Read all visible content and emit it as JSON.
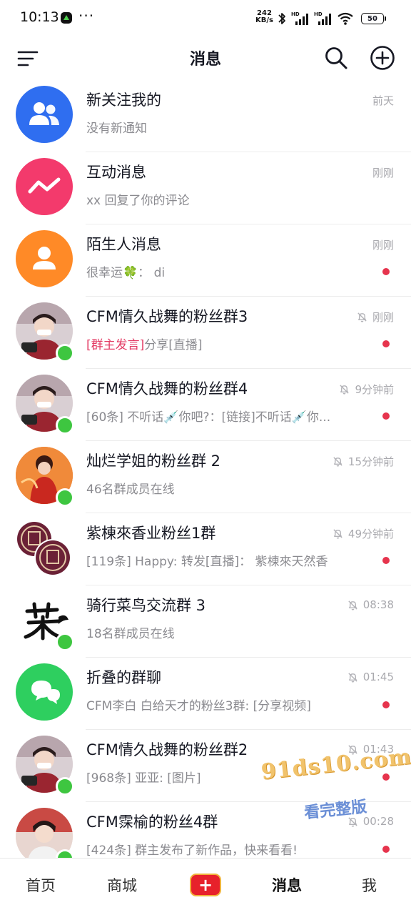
{
  "status_bar": {
    "time": "10:13",
    "dots": "···",
    "net_speed_value": "242",
    "net_speed_unit": "KB/s",
    "hd_1": "HD",
    "hd_2": "HD",
    "battery": "50"
  },
  "header": {
    "title": "消息"
  },
  "conversations": [
    {
      "title": "新关注我的",
      "subtitle": "没有新通知",
      "time": "前天",
      "muted": false,
      "unread": false,
      "online": false,
      "avatar": "followers-icon"
    },
    {
      "title": "互动消息",
      "subtitle": "xx 回复了你的评论",
      "time": "刚刚",
      "muted": false,
      "unread": false,
      "online": false,
      "avatar": "interaction-icon"
    },
    {
      "title": "陌生人消息",
      "subtitle": "很幸运🍀： di",
      "time": "刚刚",
      "muted": false,
      "unread": true,
      "online": false,
      "avatar": "stranger-icon"
    },
    {
      "title": "CFM情久战舞的粉丝群3",
      "subtitle_tag": "[群主发言]",
      "subtitle": "分享[直播]",
      "time": "刚刚",
      "muted": true,
      "unread": true,
      "online": true,
      "avatar": "group-photo"
    },
    {
      "title": "CFM情久战舞的粉丝群4",
      "subtitle": "[60条] 不听话💉你吧?：[链接]不听话💉你...",
      "time": "9分钟前",
      "muted": true,
      "unread": true,
      "online": true,
      "avatar": "group-photo"
    },
    {
      "title": "灿烂学姐的粉丝群 2",
      "subtitle": "46名群成员在线",
      "time": "15分钟前",
      "muted": true,
      "unread": false,
      "online": true,
      "avatar": "group-photo"
    },
    {
      "title": "紫棟來香业粉丝1群",
      "subtitle": "[119条] Happy: 转发[直播]： 紫棟來天然香",
      "time": "49分钟前",
      "muted": true,
      "unread": true,
      "online": false,
      "avatar": "seal-logo"
    },
    {
      "title": "骑行菜鸟交流群 3",
      "subtitle": "18名群成员在线",
      "time": "08:38",
      "muted": true,
      "unread": false,
      "online": true,
      "avatar": "calligraphy-logo"
    },
    {
      "title": "折叠的群聊",
      "subtitle": "CFM李白 白给天才的粉丝3群: [分享视频]",
      "time": "01:45",
      "muted": true,
      "unread": true,
      "online": false,
      "avatar": "folded-chat-icon"
    },
    {
      "title": "CFM情久战舞的粉丝群2",
      "subtitle": "[968条] 亚亚: [图片]",
      "time": "01:43",
      "muted": true,
      "unread": true,
      "online": true,
      "avatar": "group-photo"
    },
    {
      "title": "CFM霂榆的粉丝4群",
      "subtitle": "[424条] 群主发布了新作品，快来看看!",
      "time": "00:28",
      "muted": true,
      "unread": true,
      "online": true,
      "avatar": "group-photo"
    }
  ],
  "watermark": {
    "url": "91ds10.com",
    "text": "看完整版"
  },
  "bottom_nav": {
    "home": "首页",
    "mall": "商城",
    "plus": "+",
    "messages": "消息",
    "me": "我"
  },
  "colors": {
    "unread_dot": "#e6344d",
    "online": "#3ec640",
    "followers_avatar": "#2f6ef0",
    "interaction_avatar": "#f33a6c",
    "stranger_avatar": "#ff8a27",
    "folded_avatar": "#2ecf5f",
    "owner_tag": "#e33b64"
  }
}
